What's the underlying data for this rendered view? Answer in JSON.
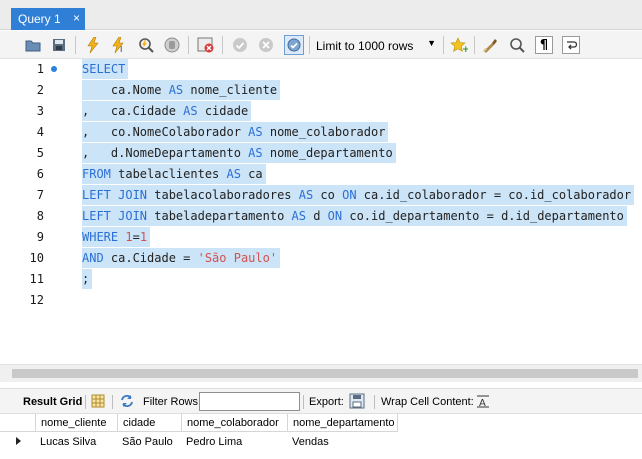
{
  "tab": {
    "label": "Query 1",
    "close": "×"
  },
  "toolbar": {
    "limit_label": "Limit to 1000 rows",
    "icons": [
      "folder-open-icon",
      "save-icon",
      "execute-icon",
      "execute-current-icon",
      "explain-icon",
      "stop-icon",
      "toggle-error-icon",
      "commit-icon",
      "rollback-icon",
      "autocommit-icon",
      "star-icon",
      "beautify-icon",
      "find-icon",
      "invisible-chars-icon",
      "wrap-icon"
    ]
  },
  "editor": {
    "lines": [
      {
        "n": "1",
        "parts": [
          {
            "t": "SELECT",
            "c": "kw"
          }
        ]
      },
      {
        "n": "2",
        "parts": [
          {
            "t": "    ca.Nome ",
            "c": ""
          },
          {
            "t": "AS",
            "c": "kw"
          },
          {
            "t": " nome_cliente",
            "c": ""
          }
        ]
      },
      {
        "n": "3",
        "parts": [
          {
            "t": ",   ca.Cidade ",
            "c": ""
          },
          {
            "t": "AS",
            "c": "kw"
          },
          {
            "t": " cidade",
            "c": ""
          }
        ]
      },
      {
        "n": "4",
        "parts": [
          {
            "t": ",   co.NomeColaborador ",
            "c": ""
          },
          {
            "t": "AS",
            "c": "kw"
          },
          {
            "t": " nome_colaborador",
            "c": ""
          }
        ]
      },
      {
        "n": "5",
        "parts": [
          {
            "t": ",   d.NomeDepartamento ",
            "c": ""
          },
          {
            "t": "AS",
            "c": "kw"
          },
          {
            "t": " nome_departamento",
            "c": ""
          }
        ]
      },
      {
        "n": "6",
        "parts": [
          {
            "t": "FROM",
            "c": "kw"
          },
          {
            "t": " tabelaclientes ",
            "c": ""
          },
          {
            "t": "AS",
            "c": "kw"
          },
          {
            "t": " ca",
            "c": ""
          }
        ]
      },
      {
        "n": "7",
        "parts": [
          {
            "t": "LEFT JOIN",
            "c": "kw"
          },
          {
            "t": " tabelacolaboradores ",
            "c": ""
          },
          {
            "t": "AS",
            "c": "kw"
          },
          {
            "t": " co ",
            "c": ""
          },
          {
            "t": "ON",
            "c": "kw"
          },
          {
            "t": " ca.id_colaborador = co.id_colaborador",
            "c": ""
          }
        ]
      },
      {
        "n": "8",
        "parts": [
          {
            "t": "LEFT JOIN",
            "c": "kw"
          },
          {
            "t": " tabeladepartamento ",
            "c": ""
          },
          {
            "t": "AS",
            "c": "kw"
          },
          {
            "t": " d ",
            "c": ""
          },
          {
            "t": "ON",
            "c": "kw"
          },
          {
            "t": " co.id_departamento = d.id_departamento",
            "c": ""
          }
        ]
      },
      {
        "n": "9",
        "parts": [
          {
            "t": "WHERE",
            "c": "kw"
          },
          {
            "t": " ",
            "c": ""
          },
          {
            "t": "1",
            "c": "num"
          },
          {
            "t": "=",
            "c": ""
          },
          {
            "t": "1",
            "c": "num"
          }
        ]
      },
      {
        "n": "10",
        "parts": [
          {
            "t": "AND",
            "c": "kw"
          },
          {
            "t": " ca.Cidade = ",
            "c": ""
          },
          {
            "t": "'São Paulo'",
            "c": "str"
          }
        ]
      },
      {
        "n": "11",
        "parts": [
          {
            "t": ";",
            "c": ""
          }
        ]
      },
      {
        "n": "12",
        "parts": []
      }
    ]
  },
  "result_toolbar": {
    "result_grid": "Result Grid",
    "filter_rows": "Filter Rows:",
    "filter_value": "",
    "export": "Export:",
    "wrap_cell": "Wrap Cell Content:"
  },
  "grid": {
    "columns": [
      "nome_cliente",
      "cidade",
      "nome_colaborador",
      "nome_departamento"
    ],
    "rows": [
      [
        "Lucas Silva",
        "São Paulo",
        "Pedro Lima",
        "Vendas"
      ]
    ]
  }
}
